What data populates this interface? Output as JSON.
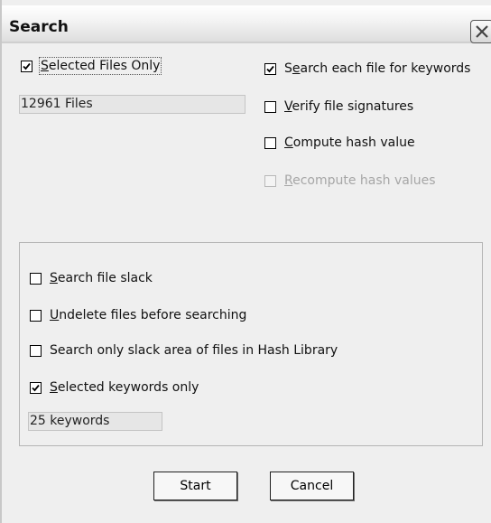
{
  "window": {
    "title": "Search",
    "close_icon": "close-x-icon"
  },
  "top_left": {
    "selected_files_only": {
      "label_u": "S",
      "label_rest": "elected Files Only",
      "checked": true
    },
    "files_count": "12961 Files"
  },
  "top_right": [
    {
      "id": "search-keywords",
      "label_pre": "S",
      "label_u": "e",
      "label_rest": "arch each file for keywords",
      "checked": true,
      "enabled": true
    },
    {
      "id": "verify-signatures",
      "label_pre": "",
      "label_u": "V",
      "label_rest": "erify file signatures",
      "checked": false,
      "enabled": true
    },
    {
      "id": "compute-hash",
      "label_pre": "",
      "label_u": "C",
      "label_rest": "ompute hash value",
      "checked": false,
      "enabled": true
    },
    {
      "id": "recompute-hash",
      "label_pre": "",
      "label_u": "R",
      "label_rest": "ecompute hash values",
      "checked": false,
      "enabled": false
    }
  ],
  "group": [
    {
      "id": "search-slack",
      "label_pre": "",
      "label_u": "S",
      "label_rest": "earch file slack",
      "checked": false
    },
    {
      "id": "undelete-files",
      "label_pre": "",
      "label_u": "U",
      "label_rest": "ndelete files before searching",
      "checked": false
    },
    {
      "id": "slack-hash-library",
      "label_pre": "Search only slack area of files in Hash Library",
      "label_u": "",
      "label_rest": "",
      "checked": false
    },
    {
      "id": "selected-keywords",
      "label_pre": "",
      "label_u": "S",
      "label_rest": "elected keywords only",
      "checked": true
    }
  ],
  "keywords_count": "25 keywords",
  "buttons": {
    "start": "Start",
    "cancel": "Cancel"
  }
}
